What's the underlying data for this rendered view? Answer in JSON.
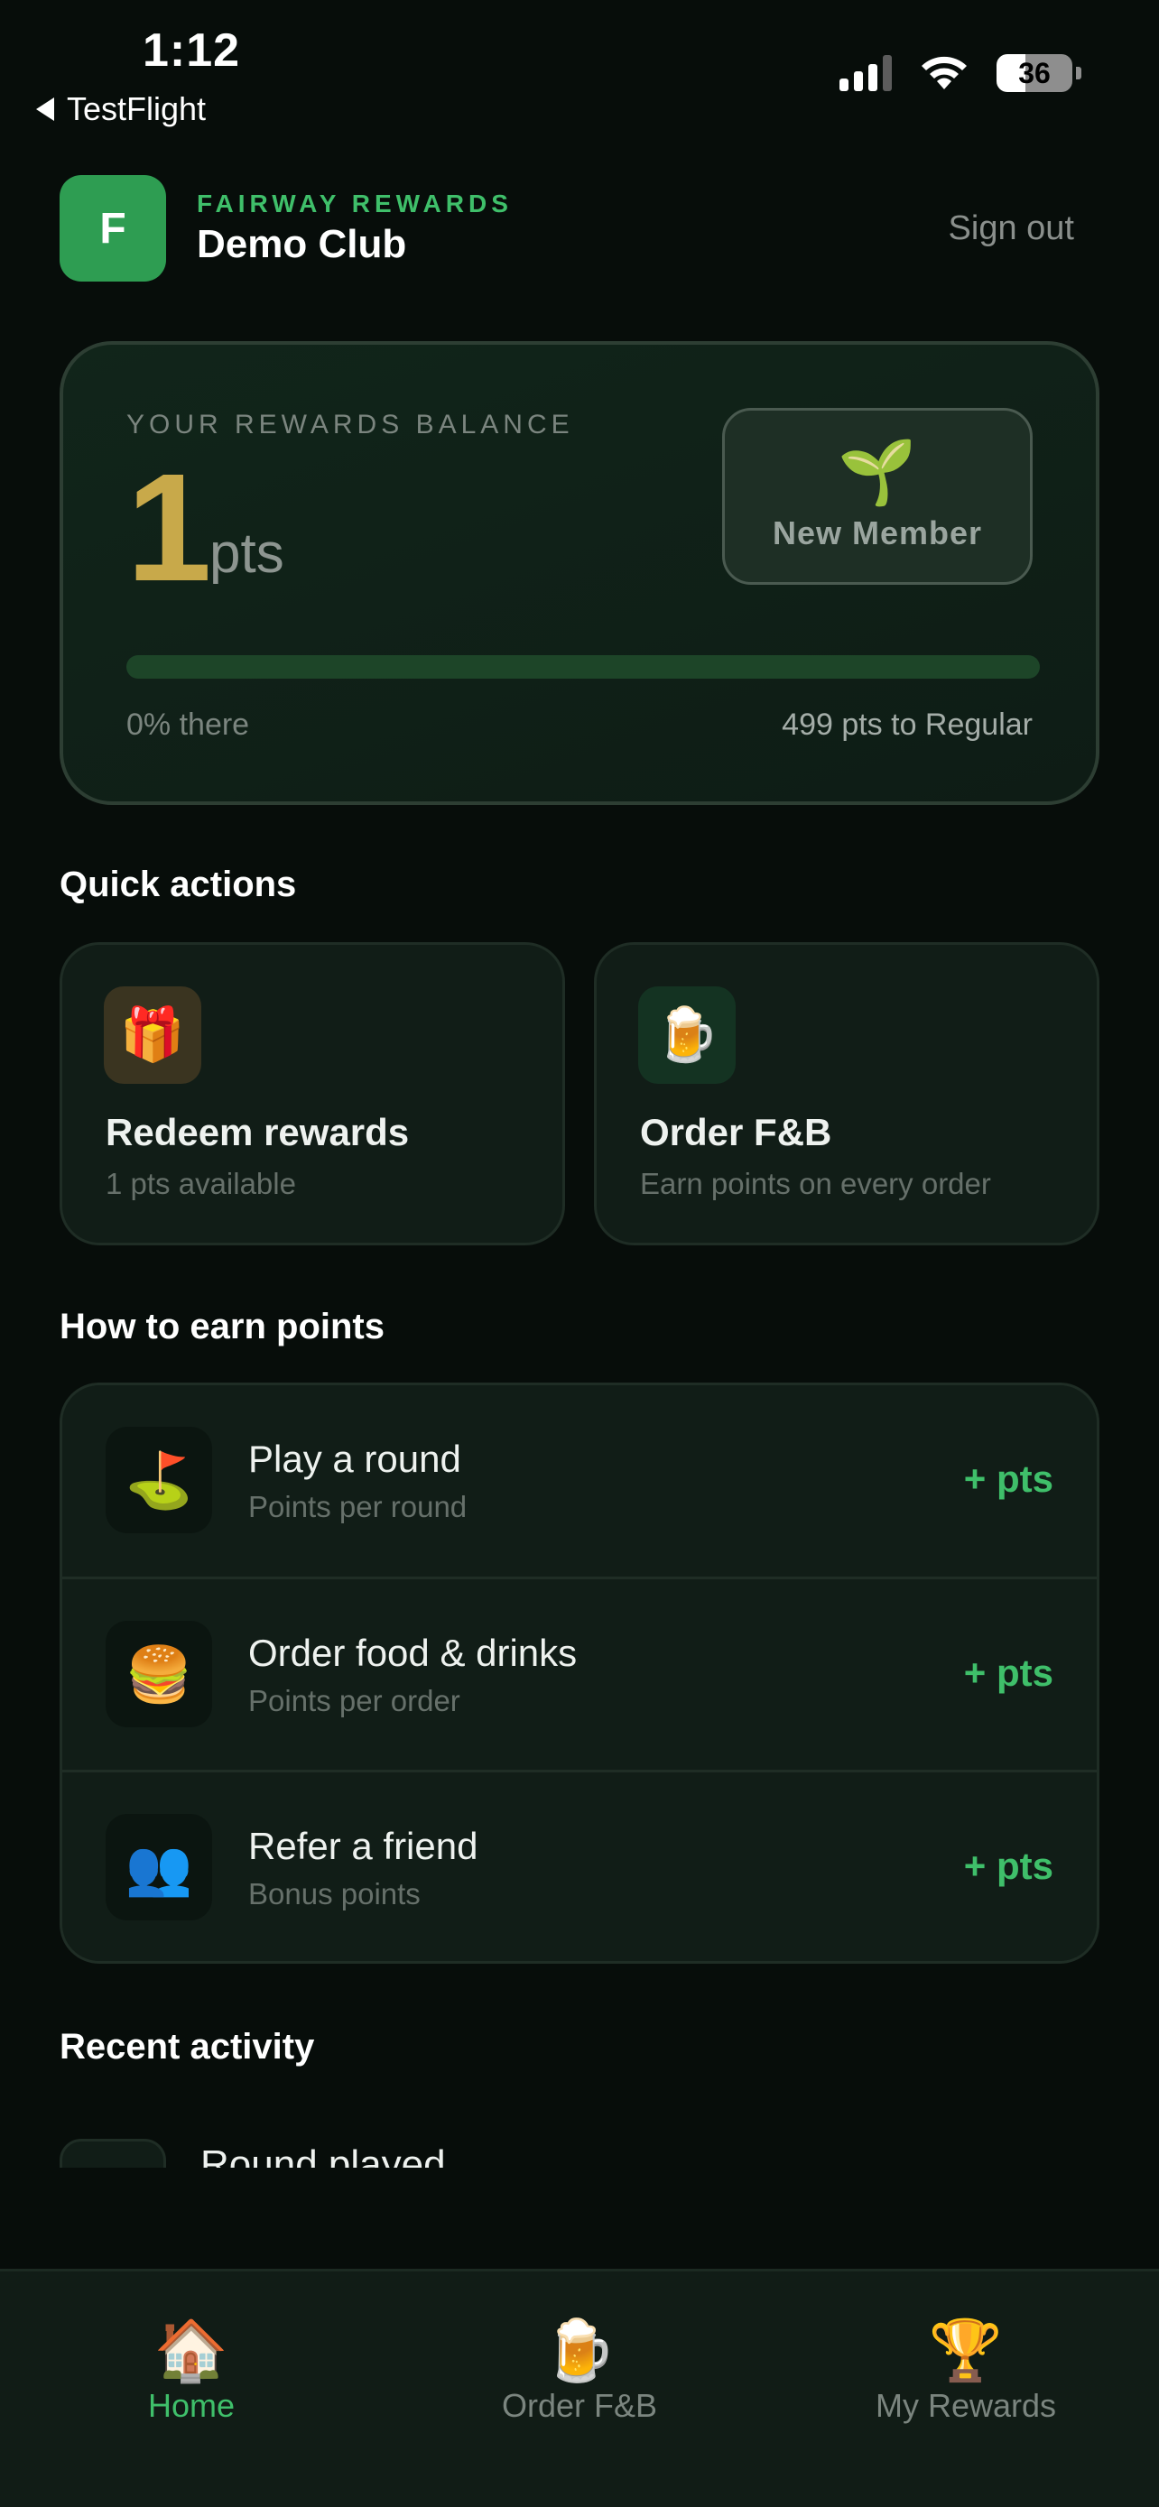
{
  "status_bar": {
    "time": "1:12",
    "back_app": "TestFlight",
    "battery": "36"
  },
  "header": {
    "logo_letter": "F",
    "brand_tagline": "FAIRWAY REWARDS",
    "club_name": "Demo Club",
    "sign_out": "Sign out"
  },
  "balance": {
    "label": "YOUR REWARDS BALANCE",
    "points": "1",
    "unit": "pts",
    "tier_icon": "🌱",
    "tier_name": "New Member",
    "progress_fraction": 0.0,
    "progress_text": "0% there",
    "next_tier_text": "499 pts to Regular"
  },
  "quick_actions": {
    "title": "Quick actions",
    "items": [
      {
        "icon": "🎁",
        "icon_name": "gift-icon",
        "title": "Redeem rewards",
        "subtitle": "1 pts available",
        "icon_bg": "#3a3420"
      },
      {
        "icon": "🍺",
        "icon_name": "beer-mug-icon",
        "title": "Order F&B",
        "subtitle": "Earn points on every order",
        "icon_bg": "#143322"
      }
    ]
  },
  "earn": {
    "title": "How to earn points",
    "items": [
      {
        "icon": "⛳",
        "icon_name": "golf-flag-icon",
        "title": "Play a round",
        "subtitle": "Points per round",
        "points": "+ pts"
      },
      {
        "icon": "🍔",
        "icon_name": "burger-icon",
        "title": "Order food & drinks",
        "subtitle": "Points per order",
        "points": "+ pts"
      },
      {
        "icon": "👥",
        "icon_name": "people-icon",
        "title": "Refer a friend",
        "subtitle": "Bonus points",
        "points": "+ pts"
      }
    ]
  },
  "recent_activity": {
    "title": "Recent activity",
    "first_item_title": "Round played"
  },
  "tabbar": {
    "items": [
      {
        "icon": "🏠",
        "label": "Home",
        "active": true
      },
      {
        "icon": "🍺",
        "label": "Order F&B",
        "active": false
      },
      {
        "icon": "🏆",
        "label": "My Rewards",
        "active": false
      }
    ]
  },
  "colors": {
    "accent_green": "#3fbf6a",
    "gold": "#c8a94a",
    "background": "#070d0a"
  }
}
